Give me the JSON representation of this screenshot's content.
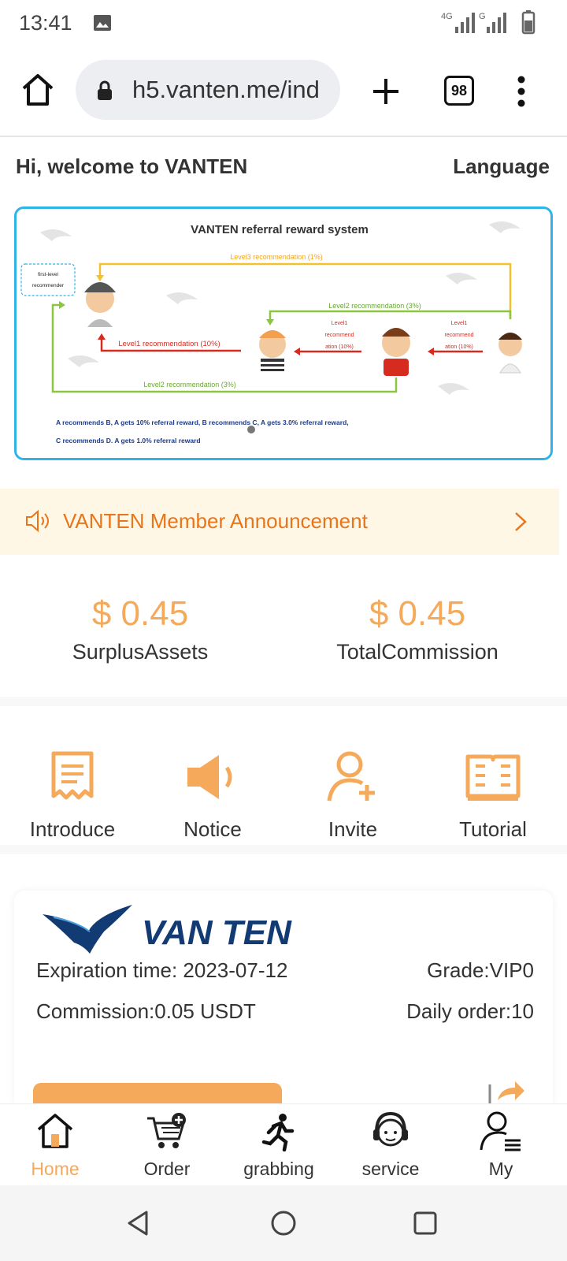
{
  "status_bar": {
    "time": "13:41",
    "network_1": "4G",
    "network_2": "G"
  },
  "browser": {
    "url": "h5.vanten.me/ind",
    "tab_count": "98"
  },
  "header": {
    "greeting": "Hi, welcome to VANTEN",
    "language": "Language"
  },
  "banner": {
    "title": "VANTEN referral reward system",
    "first_level_line1": "first-level",
    "first_level_line2": "recommender",
    "level3": "Level3 recommendation (1%)",
    "level2_top": "Level2 recommendation (3%)",
    "level1_main": "Level1 recommendation (10%)",
    "level1_mid_1": "Level1",
    "level1_mid_2": "recommend",
    "level1_mid_3": "ation (10%)",
    "level2_bottom": "Level2 recommendation (3%)",
    "footer_line1": "A recommends B, A gets 10% referral reward, B recommends C, A gets 3.0% referral reward,",
    "footer_line2": "C recommends D. A gets 1.0% referral reward"
  },
  "announcement": {
    "text": "VANTEN Member Announcement"
  },
  "assets": {
    "surplus_value": "$ 0.45",
    "surplus_label": "SurplusAssets",
    "commission_value": "$ 0.45",
    "commission_label": "TotalCommission"
  },
  "grid": [
    {
      "label": "Introduce",
      "icon": "scroll-icon"
    },
    {
      "label": "Notice",
      "icon": "speaker-icon"
    },
    {
      "label": "Invite",
      "icon": "add-user-icon"
    },
    {
      "label": "Tutorial",
      "icon": "book-icon"
    }
  ],
  "card": {
    "logo_text": "VAN TEN",
    "expiration": "Expiration time: 2023-07-12",
    "grade": "Grade:VIP0",
    "commission": "Commission:0.05 USDT",
    "daily_order": "Daily order:10"
  },
  "tabbar": [
    {
      "label": "Home",
      "icon": "home-icon",
      "active": true
    },
    {
      "label": "Order",
      "icon": "cart-icon",
      "active": false
    },
    {
      "label": "grabbing",
      "icon": "runner-icon",
      "active": false
    },
    {
      "label": "service",
      "icon": "headset-icon",
      "active": false
    },
    {
      "label": "My",
      "icon": "user-list-icon",
      "active": false
    }
  ],
  "colors": {
    "accent": "#f5a95a",
    "announce_text": "#e9751a",
    "announce_bg": "#fff7e6",
    "banner_border": "#2fb4ea"
  }
}
